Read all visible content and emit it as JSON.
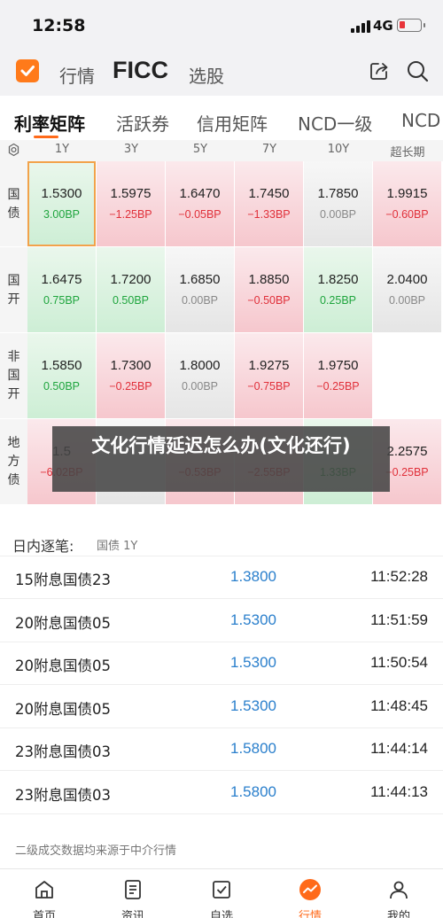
{
  "status_bar": {
    "time": "12:58",
    "network": "4G"
  },
  "header": {
    "nav": [
      "行情",
      "FICC",
      "选股"
    ],
    "icons": [
      "share-icon",
      "search-icon"
    ]
  },
  "subtabs": [
    "利率矩阵",
    "活跃券",
    "信用矩阵",
    "NCD一级",
    "NCD"
  ],
  "matrix": {
    "columns": [
      "1Y",
      "3Y",
      "5Y",
      "7Y",
      "10Y",
      "超长期"
    ],
    "rows": [
      {
        "label": [
          "国",
          "债"
        ],
        "cells": [
          {
            "v": "1.5300",
            "c": "3.00BP",
            "t": "dn",
            "sel": true
          },
          {
            "v": "1.5975",
            "c": "−1.25BP",
            "t": "up"
          },
          {
            "v": "1.6470",
            "c": "−0.05BP",
            "t": "up"
          },
          {
            "v": "1.7450",
            "c": "−1.33BP",
            "t": "up"
          },
          {
            "v": "1.7850",
            "c": "0.00BP",
            "t": "flat"
          },
          {
            "v": "1.9915",
            "c": "−0.60BP",
            "t": "up"
          }
        ]
      },
      {
        "label": [
          "国",
          "开"
        ],
        "cells": [
          {
            "v": "1.6475",
            "c": "0.75BP",
            "t": "dn"
          },
          {
            "v": "1.7200",
            "c": "0.50BP",
            "t": "dn"
          },
          {
            "v": "1.6850",
            "c": "0.00BP",
            "t": "flat"
          },
          {
            "v": "1.8850",
            "c": "−0.50BP",
            "t": "up"
          },
          {
            "v": "1.8250",
            "c": "0.25BP",
            "t": "dn"
          },
          {
            "v": "2.0400",
            "c": "0.00BP",
            "t": "flat"
          }
        ]
      },
      {
        "label": [
          "非",
          "国",
          "开"
        ],
        "cells": [
          {
            "v": "1.5850",
            "c": "0.50BP",
            "t": "dn"
          },
          {
            "v": "1.7300",
            "c": "−0.25BP",
            "t": "up"
          },
          {
            "v": "1.8000",
            "c": "0.00BP",
            "t": "flat"
          },
          {
            "v": "1.9275",
            "c": "−0.75BP",
            "t": "up"
          },
          {
            "v": "1.9750",
            "c": "−0.25BP",
            "t": "up"
          },
          {
            "v": "",
            "c": "",
            "t": "empty"
          }
        ]
      },
      {
        "label": [
          "地",
          "方",
          "债"
        ],
        "cells": [
          {
            "v": "1.5",
            "c": "−6.02BP",
            "t": "up"
          },
          {
            "v": "",
            "c": "",
            "t": "flat"
          },
          {
            "v": "",
            "c": "−0.53BP",
            "t": "up"
          },
          {
            "v": "",
            "c": "−2.55BP",
            "t": "up"
          },
          {
            "v": "",
            "c": "1.33BP",
            "t": "dn"
          },
          {
            "v": "2.2575",
            "c": "−0.25BP",
            "t": "up"
          }
        ]
      }
    ]
  },
  "overlay": {
    "text": "文化行情延迟怎么办(文化还行)"
  },
  "trades": {
    "title": "日内逐笔:",
    "subtitle": "国债 1Y",
    "rows": [
      {
        "name": "15附息国债23",
        "price": "1.3800",
        "time": "11:52:28"
      },
      {
        "name": "20附息国债05",
        "price": "1.5300",
        "time": "11:51:59"
      },
      {
        "name": "20附息国债05",
        "price": "1.5300",
        "time": "11:50:54"
      },
      {
        "name": "20附息国债05",
        "price": "1.5300",
        "time": "11:48:45"
      },
      {
        "name": "23附息国债03",
        "price": "1.5800",
        "time": "11:44:14"
      },
      {
        "name": "23附息国债03",
        "price": "1.5800",
        "time": "11:44:13"
      }
    ],
    "footnote": "二级成交数据均来源于中介行情"
  },
  "tabbar": [
    {
      "label": "首页",
      "icon": "home-icon"
    },
    {
      "label": "资讯",
      "icon": "news-icon"
    },
    {
      "label": "自选",
      "icon": "watchlist-icon"
    },
    {
      "label": "行情",
      "icon": "market-icon",
      "active": true
    },
    {
      "label": "我的",
      "icon": "profile-icon"
    }
  ],
  "colors": {
    "accent": "#ff6a1a",
    "up": "#e0303a",
    "down": "#1fa53e",
    "price": "#2a7fcc"
  }
}
